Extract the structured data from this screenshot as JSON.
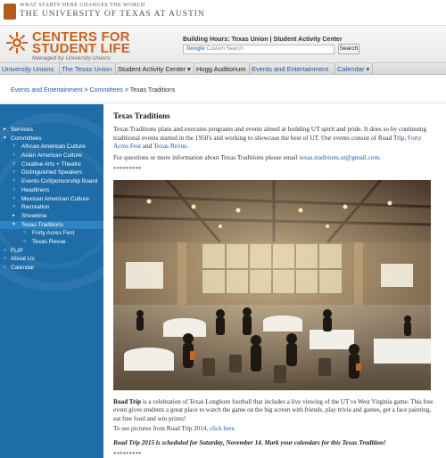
{
  "top_banner": {
    "tagline": "WHAT STARTS HERE CHANGES THE WORLD",
    "university": "THE UNIVERSITY OF TEXAS AT AUSTIN"
  },
  "header": {
    "logo_line1": "CENTERS FOR",
    "logo_line2": "STUDENT LIFE",
    "logo_sub": "Managed by University Unions",
    "building_hours_label": "Building Hours:",
    "building_hours_links": "Texas Union | Student Activity Center",
    "search_brand": "Google",
    "search_placeholder": "Custom Search",
    "search_button": "Search"
  },
  "nav": [
    {
      "label": "University Unions ▾"
    },
    {
      "label": "The Texas Union ▾"
    },
    {
      "label": "Student Activity Center ▾"
    },
    {
      "label": "Hogg Auditorium ▾"
    },
    {
      "label": "Events and Entertainment ▾"
    },
    {
      "label": "Calendar ▾"
    }
  ],
  "breadcrumb": {
    "item1": "Events and Entertainment",
    "sep": " > ",
    "item2": "Committees",
    "item3": "Texas Traditions"
  },
  "sidebar": [
    {
      "label": "Services",
      "bullet": "▸",
      "level": 0
    },
    {
      "label": "Committees",
      "bullet": "▾",
      "level": 0
    },
    {
      "label": "African American Culture",
      "bullet": "○",
      "level": 1
    },
    {
      "label": "Asian American Culture",
      "bullet": "○",
      "level": 1
    },
    {
      "label": "Creative Arts + Theatre",
      "bullet": "○",
      "level": 1
    },
    {
      "label": "Distinguished Speakers",
      "bullet": "○",
      "level": 1
    },
    {
      "label": "Events CoSponsorship Board",
      "bullet": "○",
      "level": 1
    },
    {
      "label": "Headliners",
      "bullet": "○",
      "level": 1
    },
    {
      "label": "Mexican American Culture",
      "bullet": "○",
      "level": 1
    },
    {
      "label": "Recreation",
      "bullet": "○",
      "level": 1
    },
    {
      "label": "Showtime",
      "bullet": "▸",
      "level": 1
    },
    {
      "label": "Texas Traditions",
      "bullet": "▾",
      "level": 1
    },
    {
      "label": "Forty Acres Fest",
      "bullet": "○",
      "level": 2
    },
    {
      "label": "Texas Revue",
      "bullet": "○",
      "level": 2
    },
    {
      "label": "FLIP",
      "bullet": "○",
      "level": 0
    },
    {
      "label": "About Us",
      "bullet": "○",
      "level": 0
    },
    {
      "label": "Calendar",
      "bullet": "○",
      "level": 0
    }
  ],
  "content": {
    "title": "Texas Traditions",
    "intro_text": "Texas Traditions plans and executes programs and events aimed at building UT spirit and pride. It does so by continuing traditional events started in the 1950's and working to showcase the best of UT. Our events consist of Road Trip, ",
    "intro_link1": "Forty Acres Fest",
    "intro_and": " and ",
    "intro_link2": "Texas Revue",
    "intro_end": ".",
    "contact_text": "For questions or more information about Texas Traditions please email ",
    "contact_email": "texas.traditions.ut@gmail.com",
    "contact_end": ".",
    "separator": "*********",
    "roadtrip_bold": "Road Trip",
    "roadtrip_text": " is a celebration of Texas Longhorn football that includes a live viewing of the UT vs West Virginia game. This free event gives students a great place to watch the game on the big screen with friends, play trivia and games, get a face painting, eat free food and win prizes!",
    "pics_text": "To see pictures from Road Trip 2014, ",
    "pics_link": "click here",
    "pics_end": ".",
    "schedule": "Road Trip 2015 is scheduled for Saturday, November 14. Mark your calendars for this Texas Tradition!",
    "separator2": "*********"
  },
  "colors": {
    "brand_orange": "#c8621f",
    "sidebar_blue": "#1f6da8",
    "link_blue": "#1f5aa6"
  }
}
